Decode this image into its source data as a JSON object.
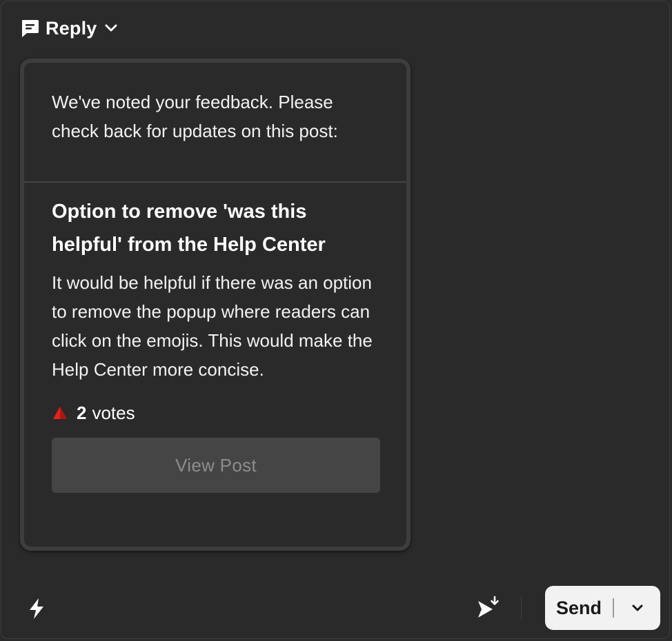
{
  "composer": {
    "mode_label": "Reply",
    "mode_icon": "chat-bubble-icon"
  },
  "card": {
    "intro_text": "We've noted your feedback. Please check back for updates on this post:",
    "post_title": "Option to remove 'was this helpful' from the Help Center",
    "post_description": "It would be helpful if there was an option to remove the popup where readers can click on the emojis. This would make the Help Center more concise.",
    "vote_count": "2",
    "vote_label": "votes",
    "vote_icon_color": "#e8221b",
    "view_button_label": "View Post"
  },
  "toolbar": {
    "shortcuts_icon": "lightning-bolt-icon",
    "send_later_icon": "send-later-icon",
    "send_label": "Send",
    "send_menu_icon": "chevron-down-icon"
  },
  "colors": {
    "background": "#2a2a2a",
    "card_border": "#3d3d3d",
    "button_disabled_bg": "#454545",
    "button_disabled_text": "#8d8d8d",
    "send_bg": "#f2f2f2"
  }
}
